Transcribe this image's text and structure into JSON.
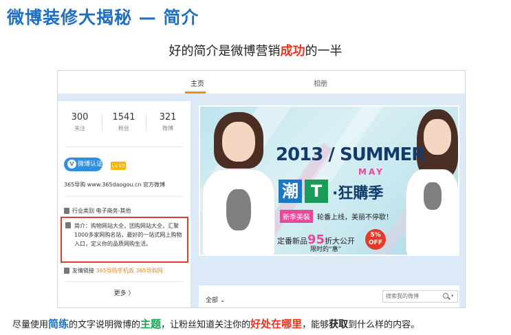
{
  "slide": {
    "title": "微博装修大揭秘 — 简介",
    "subtitle_before": "好的简介是微博营销",
    "subtitle_highlight": "成功",
    "subtitle_after": "的一半"
  },
  "nav": {
    "tab_home": "主页",
    "tab_album": "相册"
  },
  "profile": {
    "stats": [
      {
        "num": "300",
        "label": "关注"
      },
      {
        "num": "1541",
        "label": "粉丝"
      },
      {
        "num": "321",
        "label": "微博"
      }
    ],
    "verify_label": "微博认证",
    "verify_icon_text": "V",
    "vip_badge": "Lv.10",
    "account_line": "365导购 www.365daogou.cn 官方微博",
    "industry_label": "行业类别",
    "industry_value": "电子商务-其他",
    "intro_text": "简介：购物网站大全，团购网站大全，汇聚1000多家网购名站，最好的一站式网上购物入口，定义你的品质网购生活。",
    "links_label": "友情链接",
    "link_1": "365导购手机版",
    "link_2": "365导购网",
    "more_label": "更多 〉"
  },
  "banner": {
    "headline": "2013 / SUMMER",
    "month": "MAY",
    "char_1": "潮",
    "char_2": "T",
    "slogan": "·狂購季",
    "new_season": "新季美裝",
    "new_season_sub": "轮番上线，美丽不停歇！",
    "promo_prefix": "定番新品",
    "promo_number": "95",
    "promo_suffix": "折大公开",
    "promo_sub": "限时的“惠”",
    "off_line1": "5%",
    "off_line2": "OFF"
  },
  "feed": {
    "filter_label": "全部 ⌄",
    "search_placeholder": "搜索我的微博",
    "search_caret": "▾"
  },
  "footer": {
    "p1": "尽量使用",
    "h1": "简练",
    "p2": "的文字说明微博的",
    "h2": "主题",
    "p3": "，让粉丝知道关注你的",
    "h3": "好处在哪里",
    "p4": "，能够",
    "h4": "获取",
    "p5": "到什么样的内容。"
  },
  "colors": {
    "title_blue": "#1f6fc2",
    "highlight_red": "#e8351e",
    "highlight_green": "#16a34a",
    "link_orange": "#f08a24"
  }
}
